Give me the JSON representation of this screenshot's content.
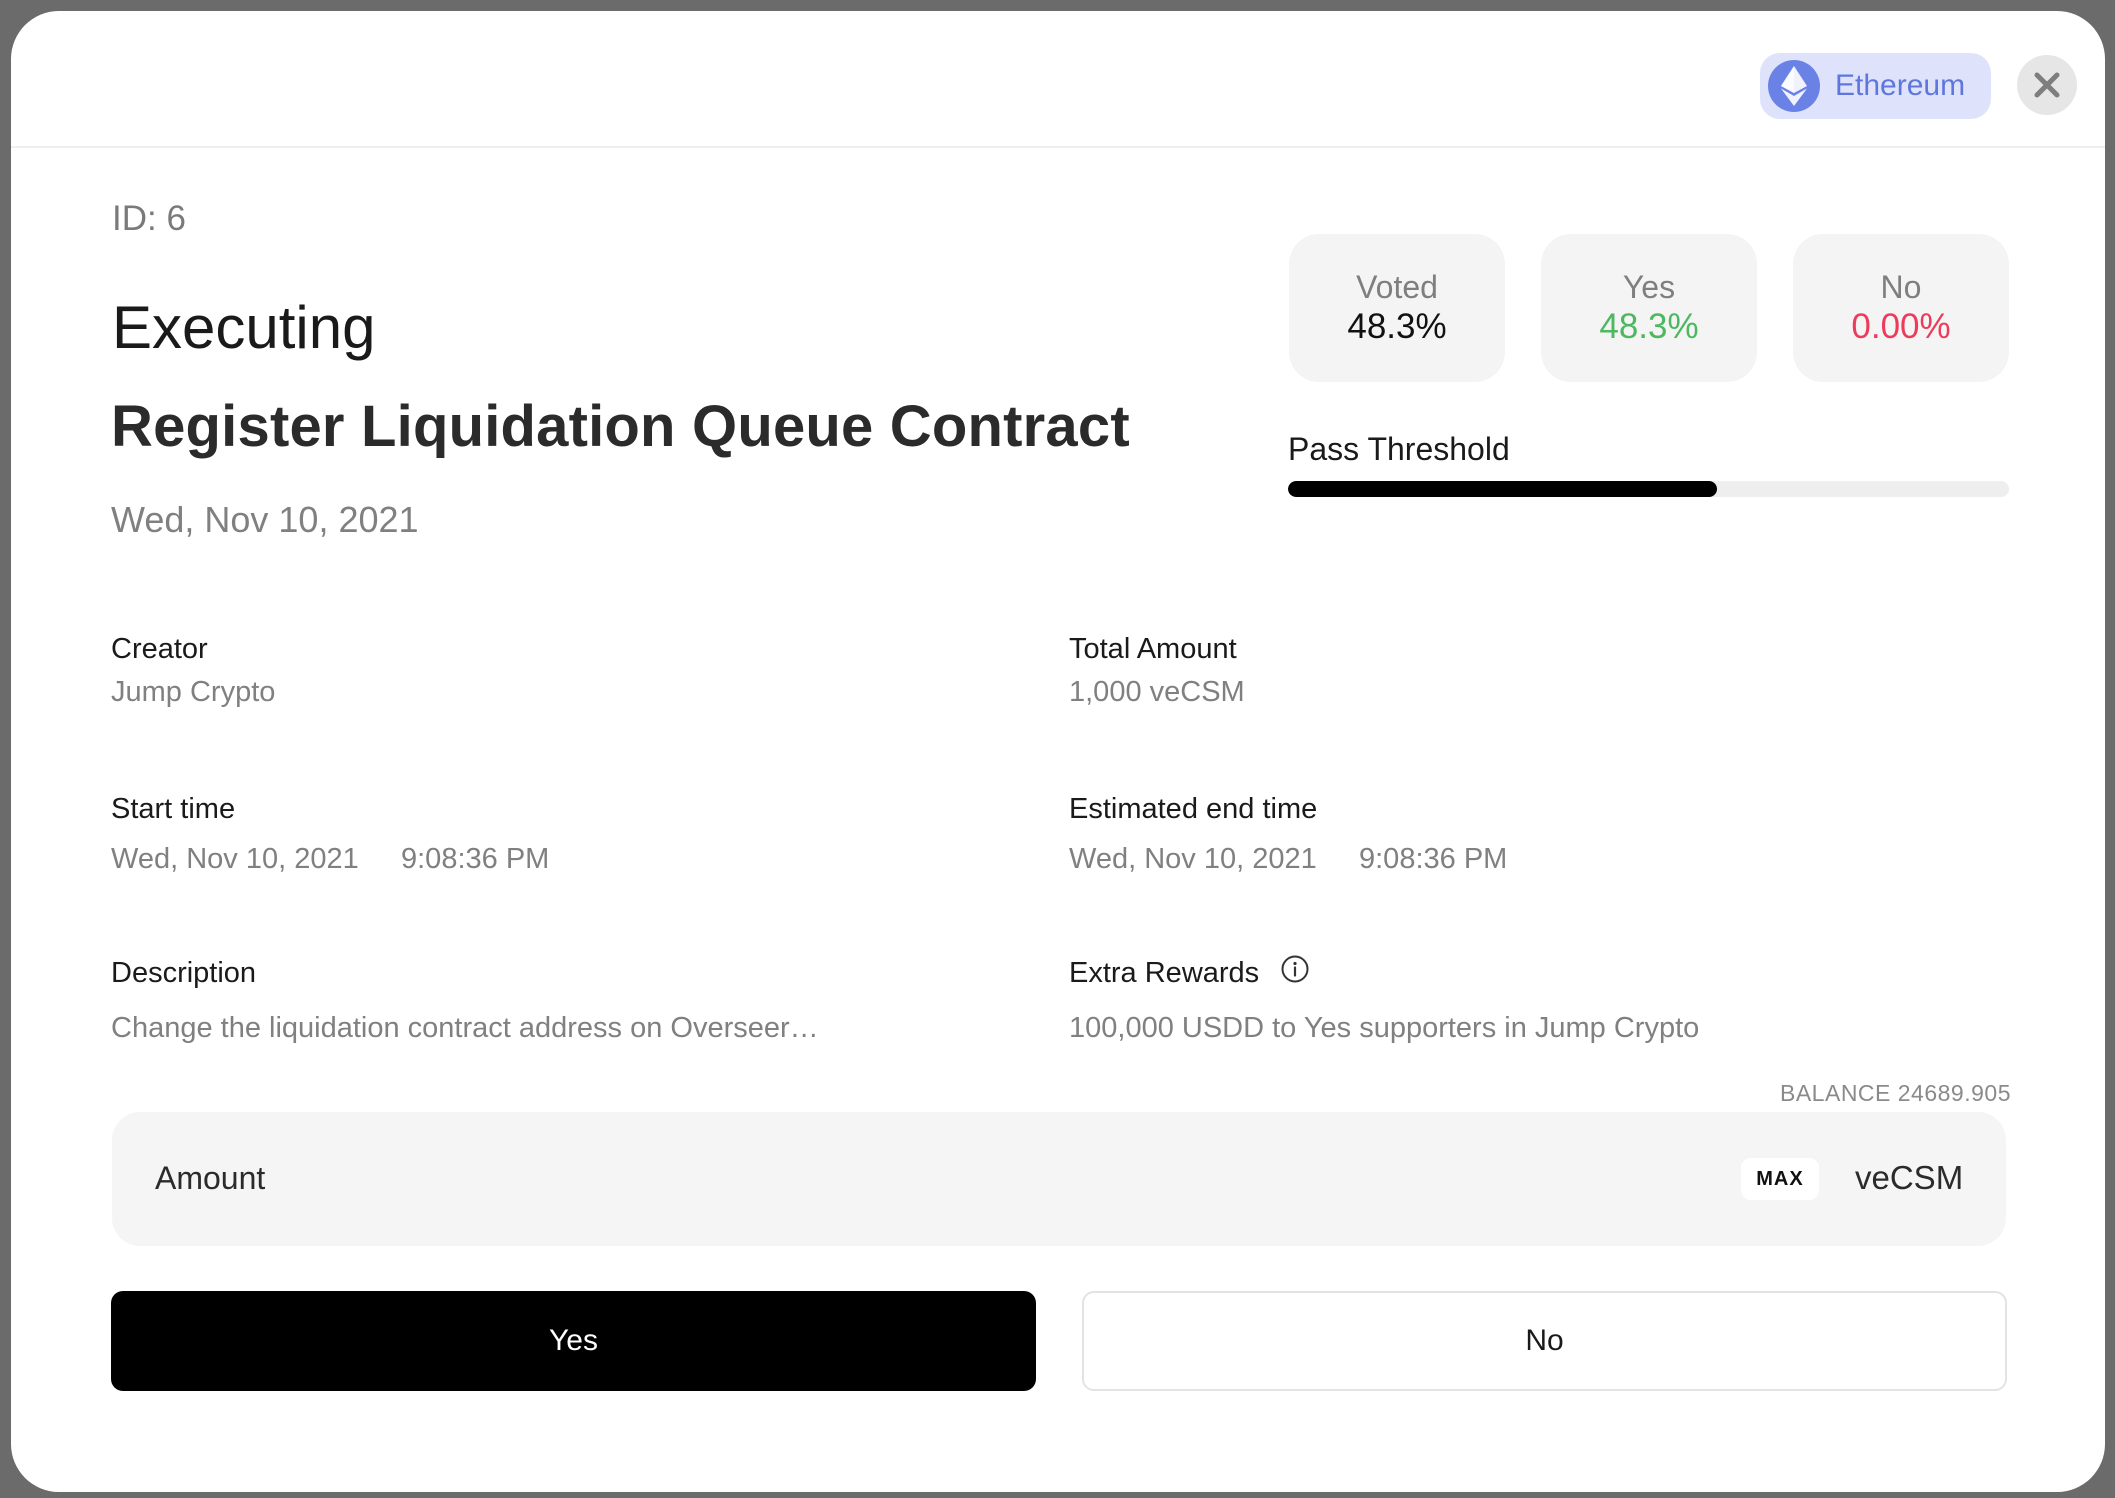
{
  "network": {
    "label": "Ethereum",
    "color": "#6a82e6"
  },
  "proposal": {
    "id_label": "ID: 6",
    "status": "Executing",
    "title": "Register Liquidation Queue Contract",
    "date": "Wed, Nov 10, 2021"
  },
  "stats": [
    {
      "title": "Voted",
      "value": "48.3%",
      "color": "#111111"
    },
    {
      "title": "Yes",
      "value": "48.3%",
      "color": "#4cb860"
    },
    {
      "title": "No",
      "value": "0.00%",
      "color": "#ec3b5b"
    }
  ],
  "threshold": {
    "label": "Pass Threshold",
    "fill_fraction": 0.595
  },
  "details": {
    "creator": {
      "label": "Creator",
      "value": "Jump Crypto"
    },
    "total_amount": {
      "label": "Total Amount",
      "value": "1,000 veCSM"
    },
    "start_time": {
      "label": "Start time",
      "date": "Wed, Nov 10, 2021",
      "time": "9:08:36 PM"
    },
    "end_time": {
      "label": "Estimated end time",
      "date": "Wed, Nov 10, 2021",
      "time": "9:08:36 PM"
    },
    "description": {
      "label": "Description",
      "value": "Change the liquidation contract address on Overseer…"
    },
    "extra_rewards": {
      "label": "Extra Rewards",
      "value": "100,000 USDD to Yes supporters in Jump Crypto"
    }
  },
  "vote": {
    "balance": "BALANCE 24689.905",
    "amount_label": "Amount",
    "max_label": "MAX",
    "unit": "veCSM",
    "yes_label": "Yes",
    "no_label": "No"
  }
}
